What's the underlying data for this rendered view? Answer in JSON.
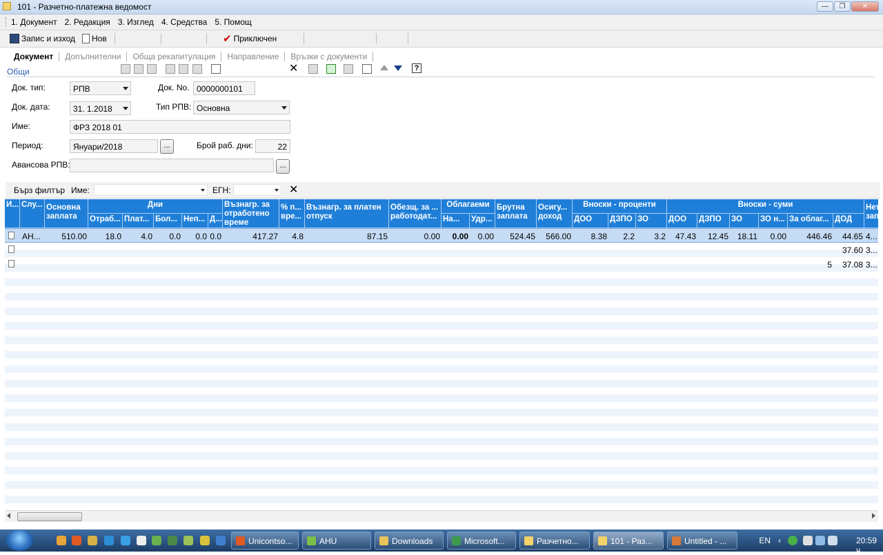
{
  "window": {
    "title": "101 - Разчетно-платежна ведомост"
  },
  "menu": [
    "1. Документ",
    "2. Редакция",
    "3. Изглед",
    "4. Средства",
    "5. Помощ"
  ],
  "toolbar": {
    "save_label": "Запис и изход",
    "new_label": "Нов",
    "closed_label": "Приключен"
  },
  "tabs": [
    "Документ",
    "Допълнителни",
    "Обща рекапитулация",
    "Направление",
    "Връзки с документи"
  ],
  "section": "Общи",
  "form": {
    "doc_type_label": "Док. тип:",
    "doc_type": "РПВ",
    "doc_no_label": "Док. No.",
    "doc_no": "0000000101",
    "doc_date_label": "Док. дата:",
    "doc_date": "31. 1.2018",
    "rpv_type_label": "Тип РПВ:",
    "rpv_type": "Основна",
    "name_label": "Име:",
    "name": "ФРЗ 2018 01",
    "period_label": "Период:",
    "period": "Януари/2018",
    "workdays_label": "Брой раб. дни:",
    "workdays": "22",
    "advance_label": "Авансова РПВ:",
    "advance": "",
    "dots": "..."
  },
  "filter": {
    "quick_label": "Бърз филтър",
    "name_label": "Име:",
    "egn_label": "ЕГН:"
  },
  "grid": {
    "headers": {
      "i": "И...",
      "slu": "Слу...",
      "base": "Основна заплата",
      "days": "Дни",
      "d1": "Отраб...",
      "d2": "Плат...",
      "d3": "Бол...",
      "d4": "Неп...",
      "d5": "Д...",
      "vazn": "Възнагр. за отработено време",
      "pct": "% п... вре...",
      "vazn_otp": "Възнагр. за платен отпуск",
      "obezsht": "Обезщ. за ... работодат...",
      "oblag": "Облагаеми",
      "o1": "На...",
      "o2": "Удр...",
      "bruto": "Брутна заплата",
      "osig": "Осигу... доход",
      "vp": "Вноски - проценти",
      "p1": "ДОО",
      "p2": "ДЗПО",
      "p3": "ЗО",
      "vs": "Вноски - суми",
      "s1": "ДОО",
      "s2": "ДЗПО",
      "s3": "ЗО",
      "s4": "ЗО н...",
      "s5": "За облаг...",
      "s6": "ДОД",
      "net": "Нет... зап..."
    },
    "rows": [
      {
        "slu": "АН...",
        "base": "510.00",
        "d1": "18.0",
        "d2": "4.0",
        "d3": "0.0",
        "d4": "0.0",
        "d5": "0.0",
        "vazn": "417.27",
        "pct": "4.8",
        "vazn_otp": "87.15",
        "obezsht": "0.00",
        "o1": "0.00",
        "o2": "0.00",
        "bruto": "524.45",
        "osig": "566.00",
        "p1": "8.38",
        "p2": "2.2",
        "p3": "3.2",
        "s1": "47.43",
        "s2": "12.45",
        "s3": "18.11",
        "s4": "0.00",
        "s5": "446.46",
        "s6": "44.65",
        "net": "4..."
      },
      {
        "s6": "37.60",
        "net": "3..."
      },
      {
        "s5": "5",
        "s6": "37.08",
        "net": "3..."
      }
    ]
  },
  "taskbar": {
    "tasks": [
      "Unicontsо...",
      "AHU",
      "Downloads",
      "Microsoft...",
      "Разчетно...",
      "101 - Раз...",
      "Untitled - ..."
    ],
    "lang": "EN",
    "clock": "20:59 ч."
  }
}
